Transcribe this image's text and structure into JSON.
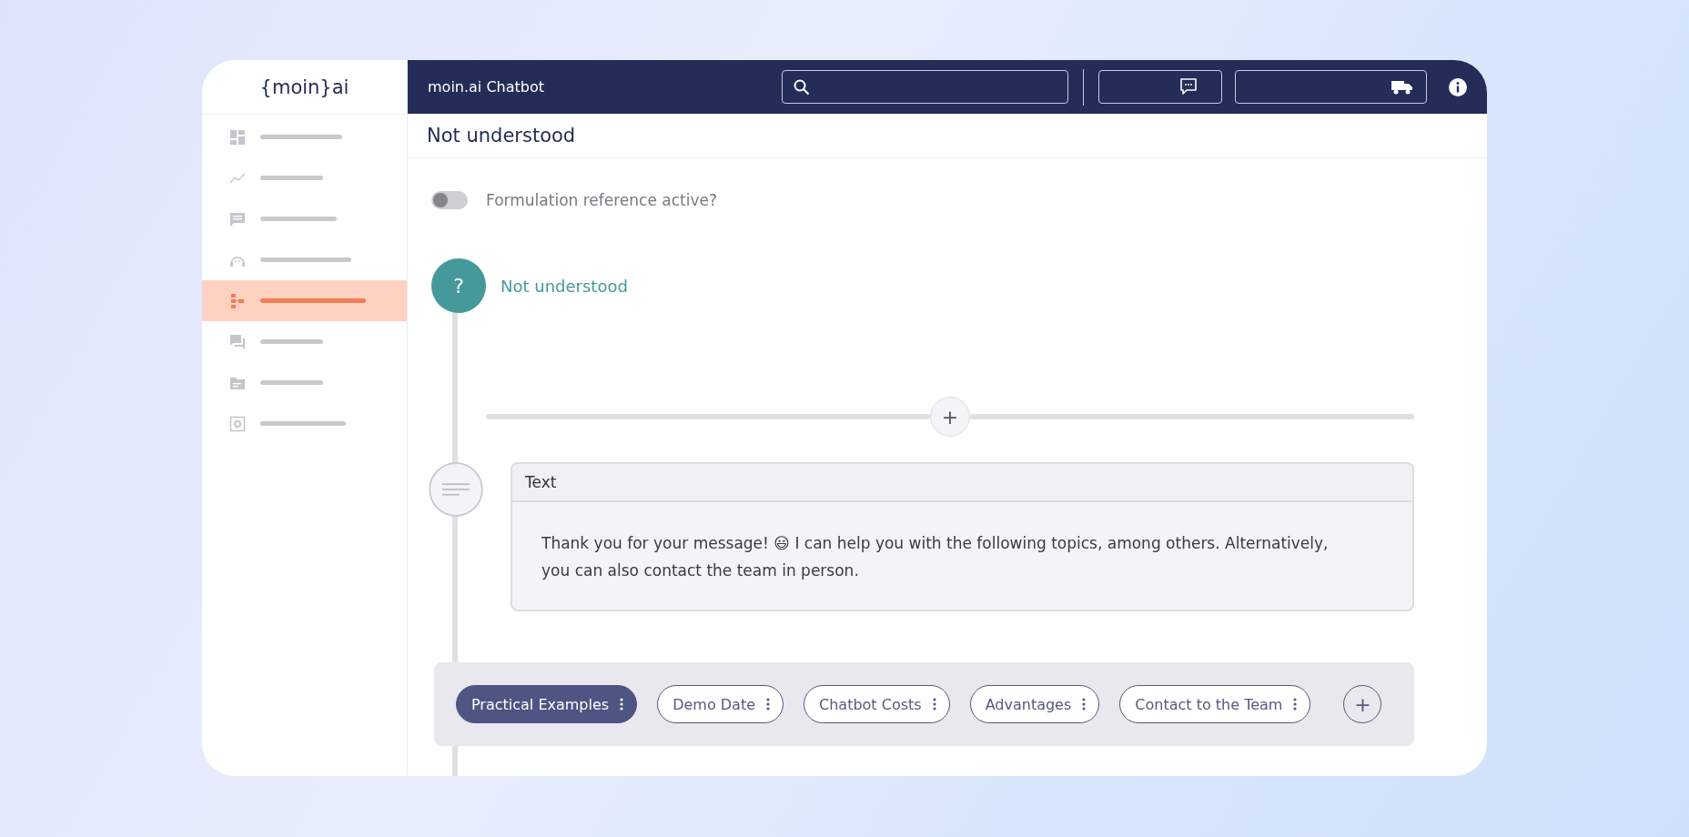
{
  "logo": {
    "text": "{moin}ai"
  },
  "sidebar": {
    "items": [
      {
        "selected": false
      },
      {
        "selected": false
      },
      {
        "selected": false
      },
      {
        "selected": false
      },
      {
        "selected": true
      },
      {
        "selected": false
      },
      {
        "selected": false
      },
      {
        "selected": false
      }
    ]
  },
  "header": {
    "title": "moin.ai Chatbot"
  },
  "page_title": "Not understood",
  "toggle": {
    "label": "Formulation reference active?",
    "on": false
  },
  "flow": {
    "start_node": {
      "symbol": "?",
      "title": "Not understood"
    },
    "add_symbol": "+",
    "text_card": {
      "title": "Text",
      "body": "Thank you for your message! 😃 I can help you with the following topics, among others. Alternatively, you can also contact the team in person."
    },
    "quick_replies": [
      {
        "label": "Practical Examples",
        "selected": true
      },
      {
        "label": "Demo Date",
        "selected": false
      },
      {
        "label": "Chatbot Costs",
        "selected": false
      },
      {
        "label": "Advantages",
        "selected": false
      },
      {
        "label": "Contact to the Team",
        "selected": false
      }
    ],
    "add_reply_symbol": "+"
  }
}
